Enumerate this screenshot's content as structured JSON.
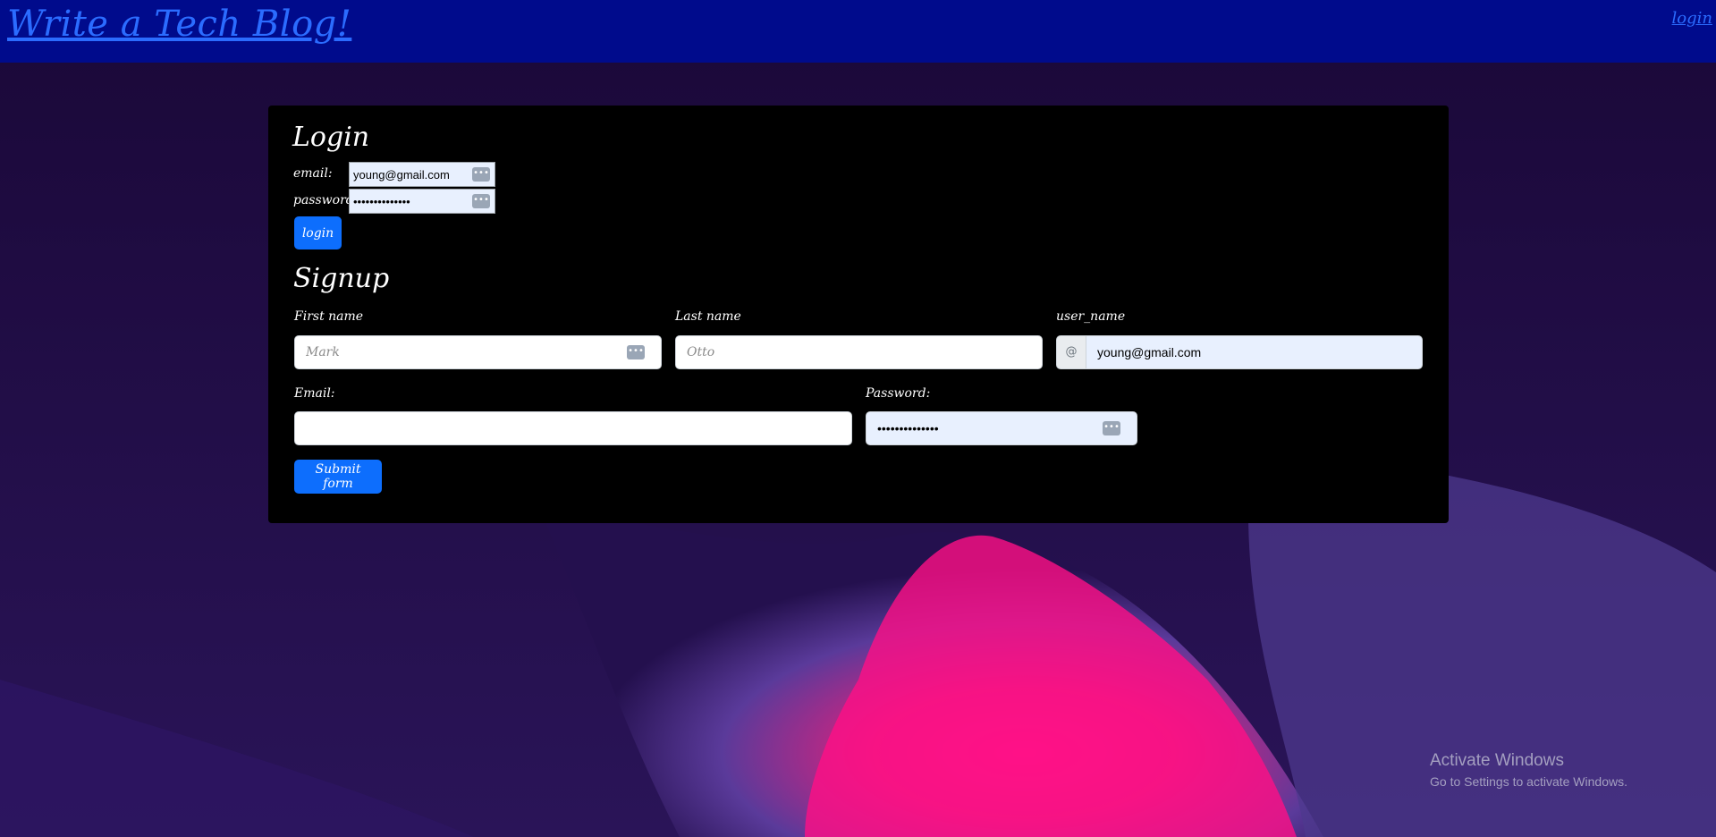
{
  "header": {
    "brand": "Write a Tech Blog!",
    "nav_login": "login"
  },
  "login": {
    "title": "Login",
    "email_label": "email:",
    "email_value": "young@gmail.com",
    "password_label": "password:",
    "password_value": "••••••••••••••",
    "submit_label": "login"
  },
  "signup": {
    "title": "Signup",
    "first_name_label": "First name",
    "first_name_placeholder": "Mark",
    "last_name_label": "Last name",
    "last_name_placeholder": "Otto",
    "username_label": "user_name",
    "username_prefix": "@",
    "username_value": "young@gmail.com",
    "email_label": "Email:",
    "email_value": "",
    "password_label": "Password:",
    "password_value": "••••••••••••••",
    "submit_label": "Submit form"
  },
  "os_watermark": {
    "title": "Activate Windows",
    "subtitle": "Go to Settings to activate Windows."
  },
  "colors": {
    "navbar": "#000b8c",
    "link": "#2b6cff",
    "button": "#0d6efd",
    "card": "#000000"
  },
  "icons": {
    "password_manager": "password-manager-key-icon"
  }
}
